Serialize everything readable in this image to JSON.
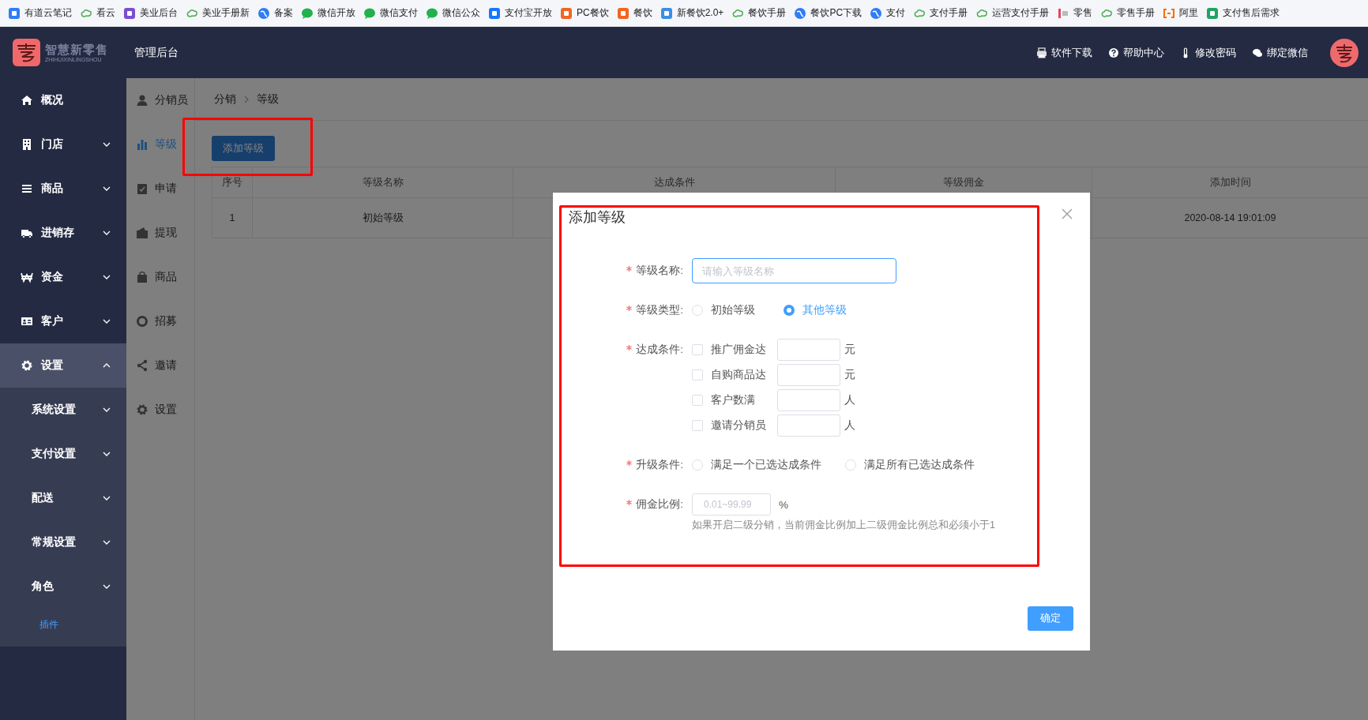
{
  "bookmarks": [
    {
      "label": "有道云笔记",
      "kind": "note"
    },
    {
      "label": "看云",
      "kind": "cloud"
    },
    {
      "label": "美业后台",
      "kind": "grid"
    },
    {
      "label": "美业手册新",
      "kind": "cloud"
    },
    {
      "label": "备案",
      "kind": "globe"
    },
    {
      "label": "微信开放",
      "kind": "chat"
    },
    {
      "label": "微信支付",
      "kind": "chat"
    },
    {
      "label": "微信公众",
      "kind": "chat"
    },
    {
      "label": "支付宝开放",
      "kind": "pay"
    },
    {
      "label": "PC餐饮",
      "kind": "food"
    },
    {
      "label": "餐饮",
      "kind": "food"
    },
    {
      "label": "新餐饮2.0+",
      "kind": "tile"
    },
    {
      "label": "餐饮手册",
      "kind": "cloud"
    },
    {
      "label": "餐饮PC下载",
      "kind": "globe"
    },
    {
      "label": "支付",
      "kind": "globe"
    },
    {
      "label": "支付手册",
      "kind": "cloud"
    },
    {
      "label": "运营支付手册",
      "kind": "cloud"
    },
    {
      "label": "零售",
      "kind": "shop"
    },
    {
      "label": "零售手册",
      "kind": "cloud"
    },
    {
      "label": "阿里",
      "kind": "bracket"
    },
    {
      "label": "支付售后需求",
      "kind": "sheet"
    }
  ],
  "header": {
    "logo_name": "智慧新零售",
    "logo_subtitle": "ZHIHUIXINLINGSHOU",
    "title": "管理后台",
    "links": [
      {
        "label": "软件下载",
        "kind": "printer"
      },
      {
        "label": "帮助中心",
        "kind": "help"
      },
      {
        "label": "修改密码",
        "kind": "key"
      },
      {
        "label": "绑定微信",
        "kind": "chat"
      }
    ]
  },
  "sidebar": {
    "items": [
      {
        "label": "概况",
        "kind": "link"
      },
      {
        "label": "门店",
        "kind": "group",
        "expanded": false
      },
      {
        "label": "商品",
        "kind": "group",
        "expanded": false
      },
      {
        "label": "进销存",
        "kind": "group",
        "expanded": false
      },
      {
        "label": "资金",
        "kind": "group",
        "expanded": false
      },
      {
        "label": "客户",
        "kind": "group",
        "expanded": false
      },
      {
        "label": "设置",
        "kind": "group",
        "expanded": true,
        "children": [
          {
            "label": "系统设置",
            "kind": "group",
            "selected": false
          },
          {
            "label": "支付设置",
            "kind": "group",
            "selected": false
          },
          {
            "label": "配送",
            "kind": "group",
            "selected": false
          },
          {
            "label": "常规设置",
            "kind": "group",
            "selected": false
          },
          {
            "label": "角色",
            "kind": "group",
            "selected": false
          },
          {
            "label": "插件",
            "kind": "link",
            "selected": true
          }
        ]
      }
    ]
  },
  "subnav": [
    {
      "label": "分销员",
      "selected": false
    },
    {
      "label": "等级",
      "selected": true
    },
    {
      "label": "申请",
      "selected": false
    },
    {
      "label": "提现",
      "selected": false
    },
    {
      "label": "商品",
      "selected": false
    },
    {
      "label": "招募",
      "selected": false
    },
    {
      "label": "邀请",
      "selected": false
    },
    {
      "label": "设置",
      "selected": false
    }
  ],
  "breadcrumb": [
    "分销",
    "等级"
  ],
  "add_button": "添加等级",
  "table": {
    "columns": [
      "序号",
      "等级名称",
      "达成条件",
      "等级佣金",
      "添加时间"
    ],
    "rows": [
      {
        "index": "1",
        "name": "初始等级",
        "time": "2020-08-14 19:01:09"
      }
    ]
  },
  "dialog": {
    "title": "添加等级",
    "name": {
      "label": "等级名称:",
      "required": true,
      "placeholder": "请输入等级名称",
      "focused": true
    },
    "type": {
      "label": "等级类型:",
      "required": true,
      "options": [
        {
          "label": "初始等级",
          "selected": false
        },
        {
          "label": "其他等级",
          "selected": true
        }
      ]
    },
    "conditions": {
      "label": "达成条件:",
      "required": true,
      "items": [
        {
          "label": "推广佣金达",
          "checked": false,
          "unit": "元"
        },
        {
          "label": "自购商品达",
          "checked": false,
          "unit": "元"
        },
        {
          "label": "客户数满",
          "checked": false,
          "unit": "人"
        },
        {
          "label": "邀请分销员",
          "checked": false,
          "unit": "人"
        }
      ]
    },
    "upgrade": {
      "label": "升级条件:",
      "required": true,
      "options": [
        {
          "label": "满足一个已选达成条件",
          "selected": false
        },
        {
          "label": "满足所有已选达成条件",
          "selected": false
        }
      ]
    },
    "commission": {
      "label": "佣金比例:",
      "required": true,
      "placeholder": "0.01~99.99",
      "unit": "%",
      "hint": "如果开启二级分销，当前佣金比例加上二级佣金比例总和必须小于1"
    },
    "confirm": "确定"
  }
}
